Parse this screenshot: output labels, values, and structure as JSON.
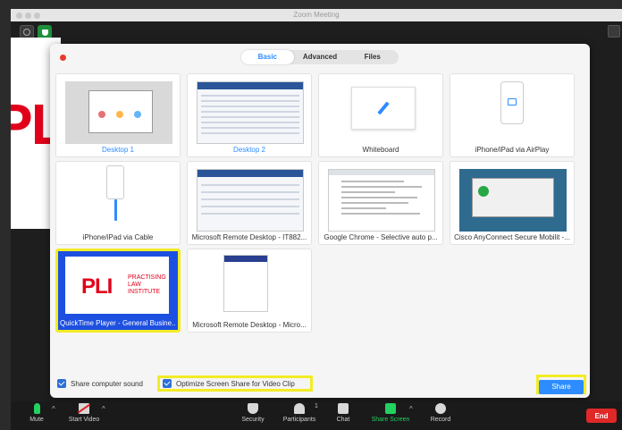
{
  "window": {
    "title": "Zoom Meeting"
  },
  "background_slide": {
    "text": "PLI"
  },
  "dialog": {
    "tabs": [
      {
        "label": "Basic",
        "active": true
      },
      {
        "label": "Advanced",
        "active": false
      },
      {
        "label": "Files",
        "active": false
      }
    ],
    "tiles": [
      {
        "label": "Desktop 1"
      },
      {
        "label": "Desktop 2"
      },
      {
        "label": "Whiteboard"
      },
      {
        "label": "iPhone/iPad via AirPlay"
      },
      {
        "label": "iPhone/iPad via Cable"
      },
      {
        "label": "Microsoft Remote Desktop - IT882..."
      },
      {
        "label": "Google Chrome - Selective auto p..."
      },
      {
        "label": "Cisco AnyConnect Secure Mobilit -..."
      },
      {
        "label": "QuickTime Player - General Busine...",
        "selected": true,
        "thumb_title": "PLI",
        "thumb_subtitle": [
          "PRACTISING",
          "LAW",
          "INSTITUTE"
        ]
      },
      {
        "label": "Microsoft Remote Desktop - Micro..."
      }
    ],
    "share_sound_label": "Share computer sound",
    "optimize_label": "Optimize Screen Share for Video Clip",
    "share_button": "Share"
  },
  "toolbar": {
    "mute": "Mute",
    "start_video": "Start Video",
    "security": "Security",
    "participants": "Participants",
    "participants_count": "1",
    "chat": "Chat",
    "share_screen": "Share Screen",
    "record": "Record",
    "end": "End"
  },
  "colors": {
    "accent": "#2d8cff",
    "highlight": "#f2ec26",
    "end": "#e02828",
    "share_green": "#23d160"
  }
}
